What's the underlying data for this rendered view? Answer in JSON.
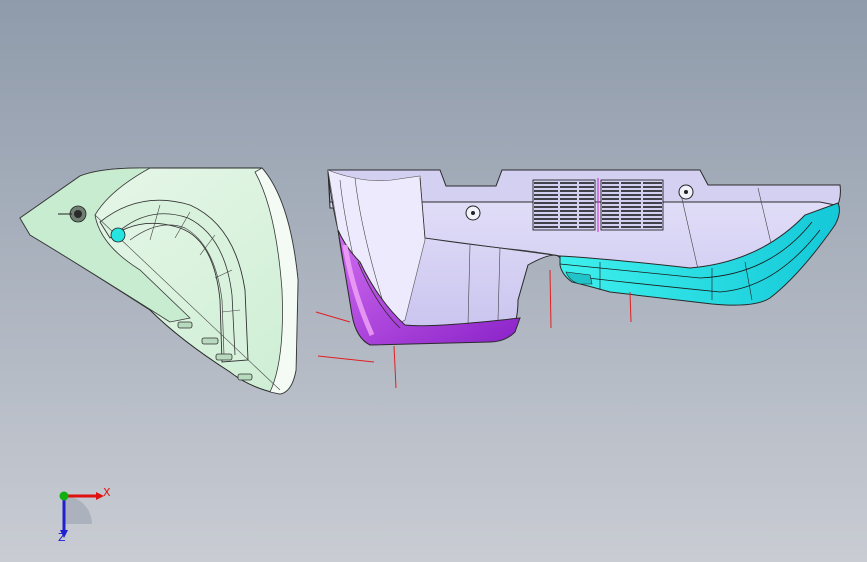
{
  "viewport": {
    "background_top": "#8f9bab",
    "background_bottom": "#c9ccd3"
  },
  "parts": [
    {
      "name": "left-cover-part",
      "color": "#dff5e2"
    },
    {
      "name": "right-housing-part",
      "color": "#dcd8f4"
    },
    {
      "name": "purple-corner-face",
      "color": "#a93bd9"
    },
    {
      "name": "cyan-trim-face",
      "color": "#25e8e4"
    }
  ],
  "triad": {
    "x_label": "X",
    "z_label": "Z",
    "x_color": "#e01010",
    "y_color": "#10b010",
    "z_color": "#2020d0"
  }
}
